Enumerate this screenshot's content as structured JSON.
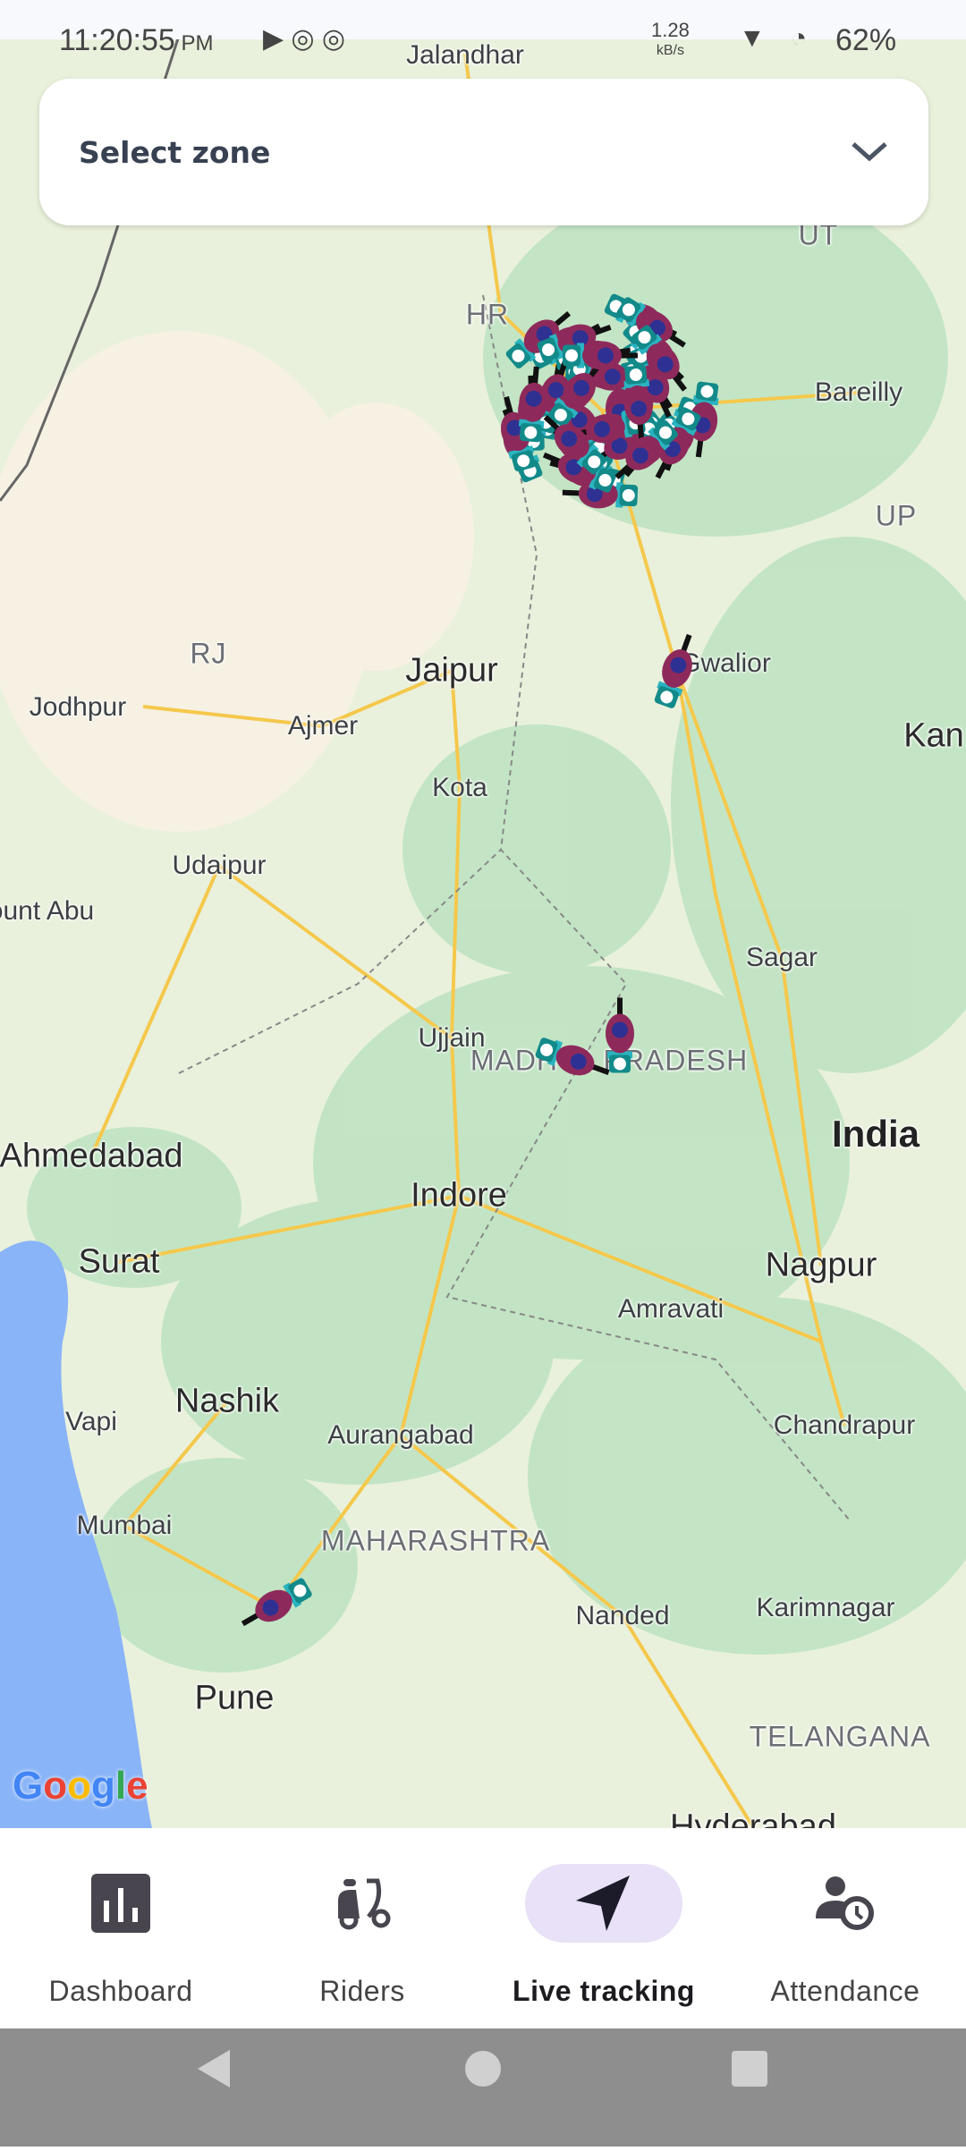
{
  "status_bar": {
    "time": "11:20:55",
    "ampm": "PM",
    "net_speed": "1.28",
    "net_unit": "kB/s",
    "battery": "62%"
  },
  "zone_select": {
    "label": "Select zone",
    "icon": "chevron-down-icon"
  },
  "map": {
    "labels": [
      {
        "text": "Jalandhar",
        "cls": ""
      },
      {
        "text": "UT",
        "cls": "state"
      },
      {
        "text": "HR",
        "cls": "state"
      },
      {
        "text": "Bareilly",
        "cls": ""
      },
      {
        "text": "UP",
        "cls": "state"
      },
      {
        "text": "RJ",
        "cls": "state"
      },
      {
        "text": "Jaipur",
        "cls": "big"
      },
      {
        "text": "Gwalior",
        "cls": ""
      },
      {
        "text": "Kan",
        "cls": "big"
      },
      {
        "text": "Jodhpur",
        "cls": ""
      },
      {
        "text": "Ajmer",
        "cls": ""
      },
      {
        "text": "Kota",
        "cls": ""
      },
      {
        "text": "Udaipur",
        "cls": ""
      },
      {
        "text": "ount Abu",
        "cls": ""
      },
      {
        "text": "Sagar",
        "cls": ""
      },
      {
        "text": "Ujjain",
        "cls": ""
      },
      {
        "text": "MADHYA PRADESH",
        "cls": "state"
      },
      {
        "text": "India",
        "cls": "bold"
      },
      {
        "text": "Ahmedabad",
        "cls": "big"
      },
      {
        "text": "Indore",
        "cls": "big"
      },
      {
        "text": "Surat",
        "cls": "big"
      },
      {
        "text": "Nagpur",
        "cls": "big"
      },
      {
        "text": "Amravati",
        "cls": ""
      },
      {
        "text": "Nashik",
        "cls": "big"
      },
      {
        "text": "Vapi",
        "cls": ""
      },
      {
        "text": "Aurangabad",
        "cls": ""
      },
      {
        "text": "Chandrapur",
        "cls": ""
      },
      {
        "text": "Mumbai",
        "cls": ""
      },
      {
        "text": "MAHARASHTRA",
        "cls": "state"
      },
      {
        "text": "Nanded",
        "cls": ""
      },
      {
        "text": "Karimnagar",
        "cls": ""
      },
      {
        "text": "Pune",
        "cls": "big"
      },
      {
        "text": "TELANGANA",
        "cls": "state"
      },
      {
        "text": "Hyderabad",
        "cls": "big"
      }
    ],
    "google_logo": "Google",
    "colors": {
      "rider": "#8e2a5b",
      "badge": "#138a8a"
    }
  },
  "nav": [
    {
      "label": "Dashboard",
      "icon": "bar-chart-icon",
      "active": false
    },
    {
      "label": "Riders",
      "icon": "scooter-icon",
      "active": false
    },
    {
      "label": "Live tracking",
      "icon": "navigation-arrow-icon",
      "active": true
    },
    {
      "label": "Attendance",
      "icon": "person-clock-icon",
      "active": false
    }
  ]
}
